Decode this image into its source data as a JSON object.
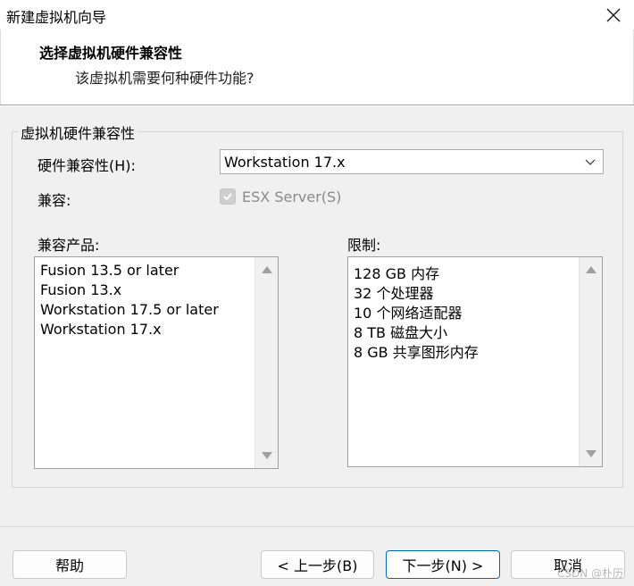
{
  "window": {
    "title": "新建虚拟机向导",
    "close_icon": "close-icon"
  },
  "header": {
    "title": "选择虚拟机硬件兼容性",
    "subtitle": "该虚拟机需要何种硬件功能?"
  },
  "group": {
    "label": "虚拟机硬件兼容性",
    "hardware_label": "硬件兼容性(H):",
    "hardware_value": "Workstation 17.x",
    "compat_label": "兼容:",
    "esx_checkbox_label": "ESX Server(S)",
    "esx_checked": true,
    "esx_enabled": false
  },
  "products": {
    "label": "兼容产品:",
    "items": [
      "Fusion 13.5 or later",
      "Fusion 13.x",
      "Workstation 17.5 or later",
      "Workstation 17.x"
    ]
  },
  "limits": {
    "label": "限制:",
    "items": [
      "128 GB 内存",
      "32 个处理器",
      "10 个网络适配器",
      "8 TB 磁盘大小",
      "8 GB 共享图形内存"
    ]
  },
  "buttons": {
    "help": "帮助",
    "back": "< 上一步(B)",
    "next": "下一步(N) >",
    "cancel": "取消"
  },
  "watermark": "CSDN @朴历"
}
